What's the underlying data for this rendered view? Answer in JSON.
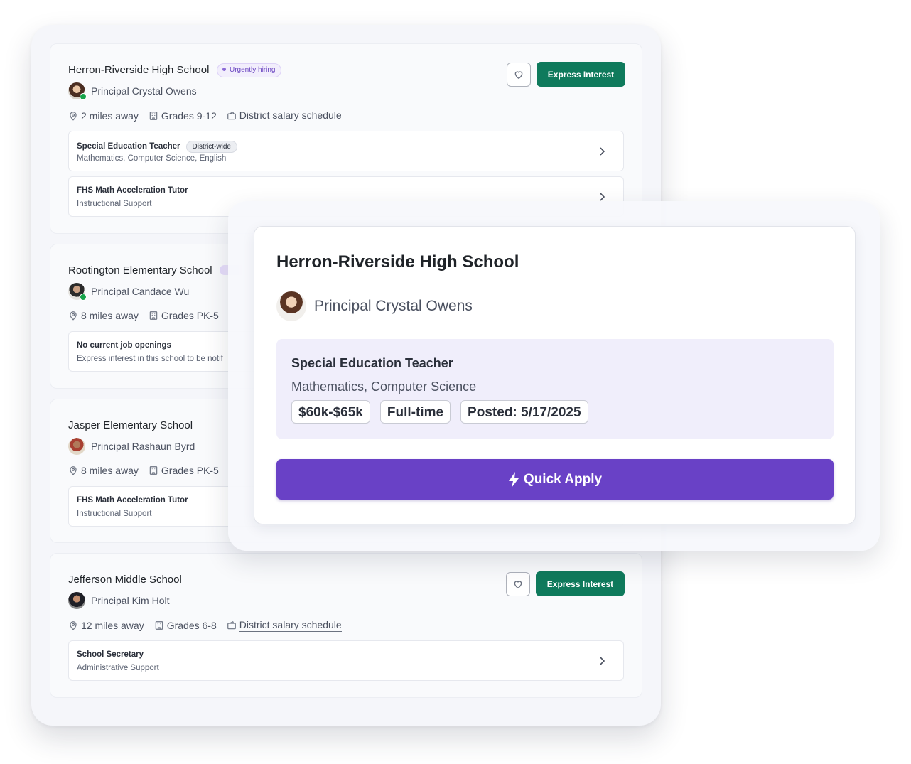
{
  "cards": [
    {
      "school": "Herron-Riverside High School",
      "badge": "Urgently hiring",
      "principal": "Principal Crystal Owens",
      "distance": "2 miles away",
      "grades": "Grades 9-12",
      "salary_link": "District salary schedule",
      "express_label": "Express Interest",
      "jobs": [
        {
          "title": "Special Education Teacher",
          "tag": "District-wide",
          "subtitle": "Mathematics, Computer Science, English"
        },
        {
          "title": "FHS Math Acceleration Tutor",
          "subtitle": "Instructional Support"
        }
      ]
    },
    {
      "school": "Rootington Elementary School",
      "principal": "Principal Candace Wu",
      "distance": "8 miles away",
      "grades": "Grades PK-5",
      "jobs": [
        {
          "title": "No current job openings",
          "subtitle": "Express interest in this school to be notif"
        }
      ]
    },
    {
      "school": "Jasper Elementary School",
      "principal": "Principal Rashaun Byrd",
      "distance": "8 miles away",
      "grades": "Grades PK-5",
      "jobs": [
        {
          "title": "FHS Math Acceleration Tutor",
          "subtitle": "Instructional Support"
        }
      ]
    },
    {
      "school": "Jefferson Middle School",
      "principal": "Principal Kim Holt",
      "distance": "12 miles away",
      "grades": "Grades 6-8",
      "salary_link": "District salary schedule",
      "express_label": "Express Interest",
      "jobs": [
        {
          "title": "School Secretary",
          "subtitle": "Administrative Support"
        }
      ]
    }
  ],
  "overlay": {
    "school": "Herron-Riverside High School",
    "principal": "Principal Crystal Owens",
    "job_title": "Special Education Teacher",
    "job_subjects": "Mathematics, Computer Science",
    "chips": [
      "$60k-$65k",
      "Full-time",
      "Posted: 5/17/2025"
    ],
    "apply_label": "Quick Apply"
  },
  "colors": {
    "accent_green": "#0f7a5c",
    "accent_purple": "#6941c6",
    "online": "#16a34a"
  },
  "icons": [
    "heart-icon",
    "map-pin-icon",
    "school-building-icon",
    "wallet-icon",
    "chevron-right-icon",
    "lightning-icon"
  ]
}
